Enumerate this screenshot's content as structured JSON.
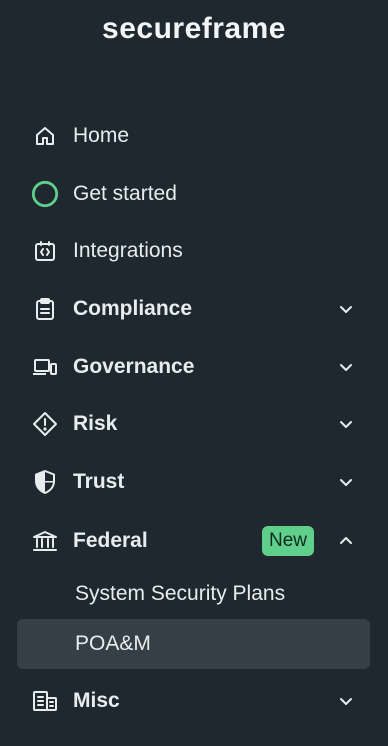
{
  "brand": {
    "name": "secureframe"
  },
  "nav": {
    "home": "Home",
    "get_started": "Get started",
    "integrations": "Integrations",
    "compliance": "Compliance",
    "governance": "Governance",
    "risk": "Risk",
    "trust": "Trust",
    "federal": "Federal",
    "federal_badge": "New",
    "federal_children": [
      "System Security Plans",
      "POA&M"
    ],
    "misc": "Misc"
  },
  "colors": {
    "background": "#1f282e",
    "active_item": "#363f45",
    "accent_green": "#5fcf8c"
  }
}
